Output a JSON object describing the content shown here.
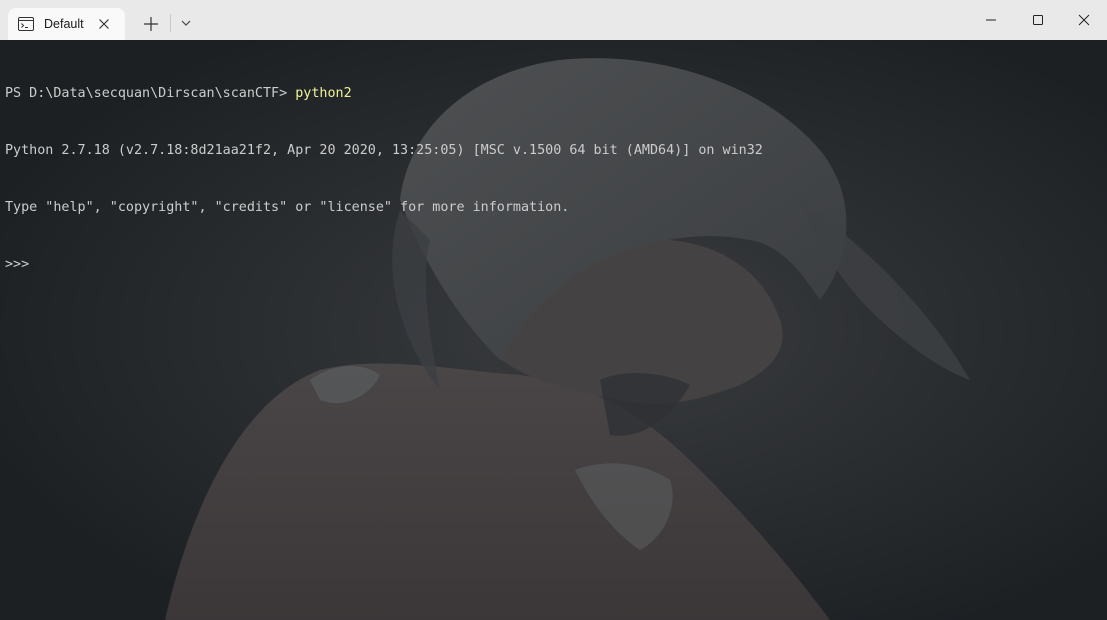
{
  "window": {
    "tab_title": "Default",
    "tab_icon": "terminal-icon",
    "controls": [
      "minimize-icon",
      "maximize-icon",
      "close-icon"
    ]
  },
  "terminal": {
    "prompt": "PS D:\\Data\\secquan\\Dirscan\\scanCTF> ",
    "command": "python2",
    "output": [
      "Python 2.7.18 (v2.7.18:8d21aa21f2, Apr 20 2020, 13:25:05) [MSC v.1500 64 bit (AMD64)] on win32",
      "Type \"help\", \"copyright\", \"credits\" or \"license\" for more information."
    ],
    "repl_prompt": ">>>"
  },
  "colors": {
    "titlebar": "#e9e9e9",
    "tab_active": "#f9f9f9",
    "terminal_bg": "#1d2124",
    "terminal_text": "#cccccc",
    "command_text": "#f2f29a"
  }
}
